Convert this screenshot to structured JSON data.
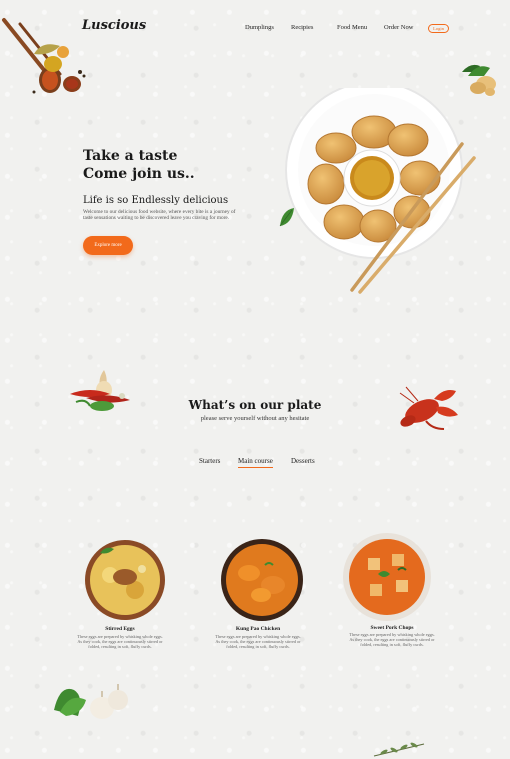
{
  "brand": {
    "logo": "Luscious"
  },
  "nav": {
    "items": [
      "Dumplings",
      "Recipies",
      "Food Menu",
      "Order Now"
    ],
    "login": "Login"
  },
  "hero": {
    "title_line1": "Take a taste",
    "title_line2": "Come join us..",
    "subtitle": "Life is so Endlessly delicious",
    "description": "Welcome to our delicious food website, where every bite is a journey of taste sensations waiting to be discovered leave you craving for more.",
    "cta": "Explore more"
  },
  "plate_section": {
    "title": "What’s on our plate",
    "subtitle": "please serve yourself without any hesitate",
    "tabs": [
      "Starters",
      "Main course",
      "Desserts"
    ],
    "active_tab": "Main course"
  },
  "dishes": [
    {
      "name": "Stirred Eggs",
      "description": "These eggs are prepared by whisking whole eggs. As they cook, the eggs are continuously stirred or folded, resulting in soft, fluffy curds."
    },
    {
      "name": "Kung Pao Chicken",
      "description": "These eggs are prepared by whisking whole eggs. As they cook, the eggs are continuously stirred or folded, resulting in soft, fluffy curds."
    },
    {
      "name": "Sweet Pork Chops",
      "description": "These eggs are prepared by whisking whole eggs. As they cook, the eggs are continuously stirred or folded, resulting in soft, fluffy curds."
    }
  ],
  "colors": {
    "accent": "#f26a1b",
    "background": "#f1f1ef",
    "text": "#1a1a1a"
  },
  "icons": [
    "spice-spoons-icon",
    "ginger-icon",
    "dumpling-plate-icon",
    "leaf-icon",
    "vegetables-icon",
    "lobster-icon",
    "garlic-icon",
    "herb-icon"
  ]
}
